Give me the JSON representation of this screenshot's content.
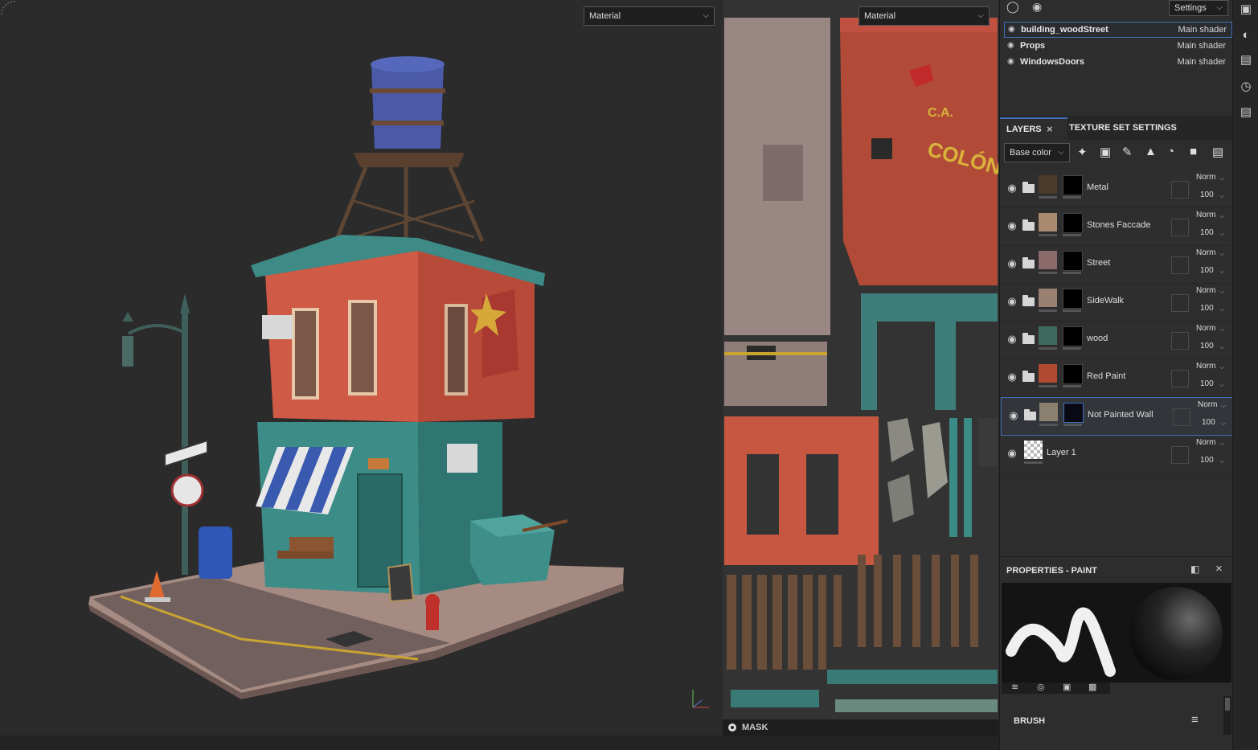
{
  "viewport3d": {
    "material_select": "Material"
  },
  "viewport2d": {
    "material_select": "Material",
    "mask_label": "MASK",
    "wall_text_line1": "C.A.",
    "wall_text_line2": "COLÓN"
  },
  "top_bar": {
    "settings_label": "Settings"
  },
  "texture_sets": [
    {
      "name": "building_woodStreet",
      "shader": "Main shader"
    },
    {
      "name": "Props",
      "shader": "Main shader"
    },
    {
      "name": "WindowsDoors",
      "shader": "Main shader"
    }
  ],
  "tabs": {
    "layers": "LAYERS",
    "texture_set_settings": "TEXTURE SET SETTINGS"
  },
  "channel_select": "Base color",
  "layers": [
    {
      "name": "Metal",
      "blend": "Norm",
      "opacity": "100",
      "thumb": "#4a3a2a",
      "mask": "#000000"
    },
    {
      "name": "Stones Faccade",
      "blend": "Norm",
      "opacity": "100",
      "thumb": "#a88a70",
      "mask": "#000000"
    },
    {
      "name": "Street",
      "blend": "Norm",
      "opacity": "100",
      "thumb": "#8a6a6a",
      "mask": "#000000"
    },
    {
      "name": "SideWalk",
      "blend": "Norm",
      "opacity": "100",
      "thumb": "#9a8070",
      "mask": "#000000"
    },
    {
      "name": "wood",
      "blend": "Norm",
      "opacity": "100",
      "thumb": "#3f6a60",
      "mask": "#000000"
    },
    {
      "name": "Red Paint",
      "blend": "Norm",
      "opacity": "100",
      "thumb": "#b04a30",
      "mask": "#000000"
    },
    {
      "name": "Not Painted Wall",
      "blend": "Norm",
      "opacity": "100",
      "thumb": "#8a8070",
      "mask": "#0a0a14"
    },
    {
      "name": "Layer 1",
      "blend": "Norm",
      "opacity": "100",
      "thumb": "checker",
      "mask": ""
    }
  ],
  "properties": {
    "title": "PROPERTIES - PAINT",
    "brush_label": "BRUSH"
  },
  "colors": {
    "accent_selection": "#3d6fb8",
    "panel_bg": "#2d2d2d",
    "viewport_bg": "#2b2b2b"
  }
}
